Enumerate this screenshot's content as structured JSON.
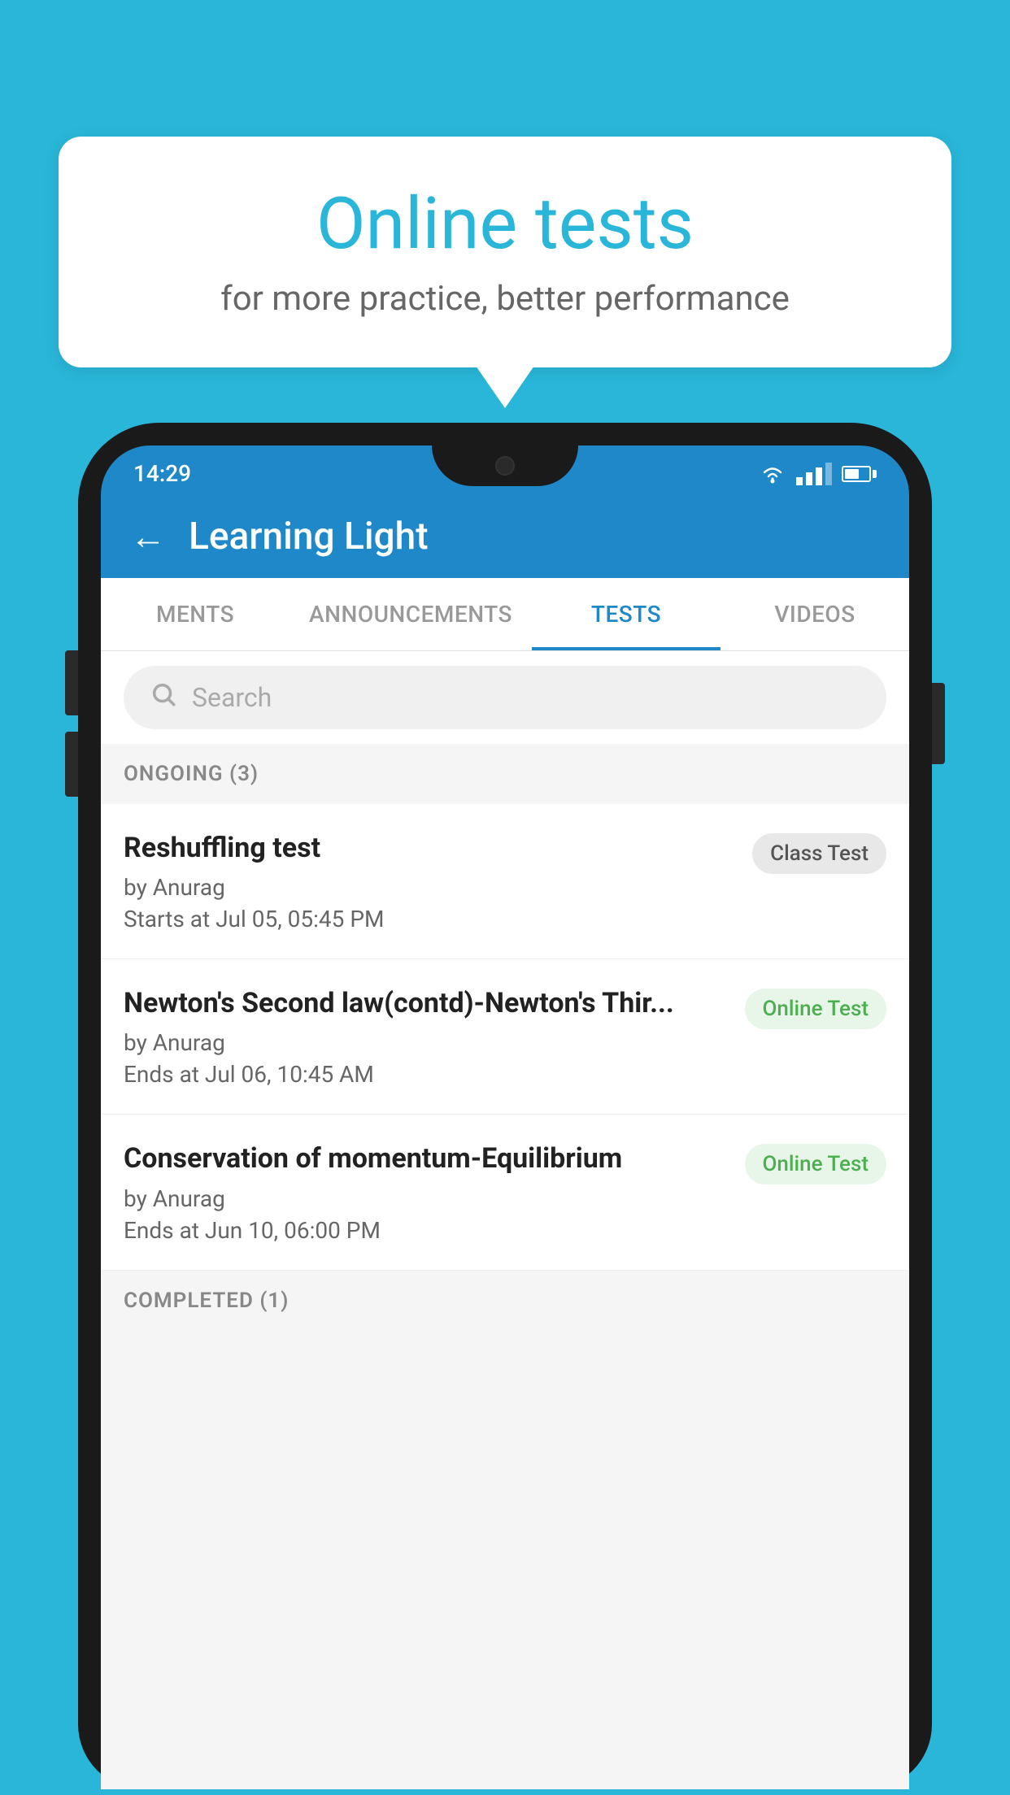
{
  "background_color": "#29b6d8",
  "speech_bubble": {
    "title": "Online tests",
    "subtitle": "for more practice, better performance"
  },
  "phone": {
    "status_bar": {
      "time": "14:29"
    },
    "header": {
      "title": "Learning Light",
      "back_label": "←"
    },
    "tabs": [
      {
        "label": "MENTS",
        "active": false
      },
      {
        "label": "ANNOUNCEMENTS",
        "active": false
      },
      {
        "label": "TESTS",
        "active": true
      },
      {
        "label": "VIDEOS",
        "active": false
      }
    ],
    "search": {
      "placeholder": "Search"
    },
    "ongoing_section": {
      "label": "ONGOING (3)"
    },
    "tests": [
      {
        "name": "Reshuffling test",
        "author": "by Anurag",
        "time": "Starts at  Jul 05, 05:45 PM",
        "badge": "Class Test",
        "badge_type": "class"
      },
      {
        "name": "Newton's Second law(contd)-Newton's Thir...",
        "author": "by Anurag",
        "time": "Ends at  Jul 06, 10:45 AM",
        "badge": "Online Test",
        "badge_type": "online"
      },
      {
        "name": "Conservation of momentum-Equilibrium",
        "author": "by Anurag",
        "time": "Ends at  Jun 10, 06:00 PM",
        "badge": "Online Test",
        "badge_type": "online"
      }
    ],
    "completed_section": {
      "label": "COMPLETED (1)"
    }
  }
}
